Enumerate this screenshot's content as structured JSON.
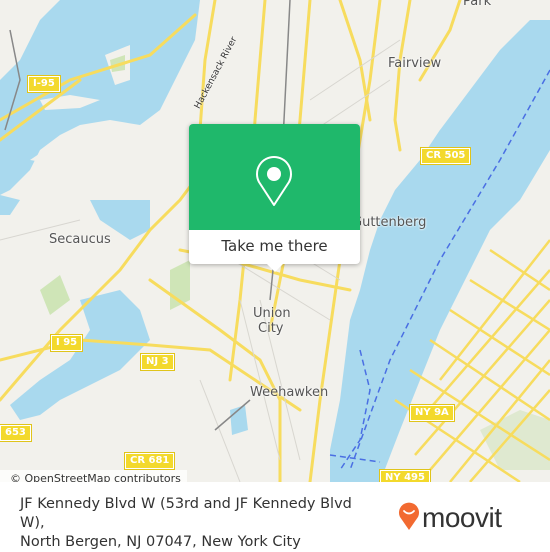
{
  "map": {
    "place_labels": [
      {
        "id": "fairview",
        "text": "Fairview"
      },
      {
        "id": "park",
        "text": "Park"
      },
      {
        "id": "secaucus",
        "text": "Secaucus"
      },
      {
        "id": "guttenberg",
        "text": "Guttenberg"
      },
      {
        "id": "union-city-1",
        "text": "Union"
      },
      {
        "id": "union-city-2",
        "text": "City"
      },
      {
        "id": "weehawken",
        "text": "Weehawken"
      }
    ],
    "water_labels": [
      {
        "id": "hackensack",
        "text": "Hackensack River"
      }
    ],
    "route_shields": [
      {
        "id": "i95-top",
        "text": "I-95"
      },
      {
        "id": "i95-mid",
        "text": "I 95"
      },
      {
        "id": "nj3",
        "text": "NJ 3"
      },
      {
        "id": "cr505",
        "text": "CR 505"
      },
      {
        "id": "ny9a",
        "text": "NY 9A"
      },
      {
        "id": "653",
        "text": "653"
      },
      {
        "id": "cr681",
        "text": "CR 681"
      },
      {
        "id": "ny495",
        "text": "NY 495"
      }
    ],
    "attribution": "© OpenStreetMap contributors",
    "colors": {
      "water": "#a9d9ee",
      "land": "#f2f1ec",
      "road": "#f7dc5e",
      "park": "#cfe5b7",
      "ferry": "#4a6fe3"
    }
  },
  "popup": {
    "icon": "map-pin-icon",
    "button_label": "Take me there",
    "color": "#1fb86b"
  },
  "footer": {
    "address_line1": "JF Kennedy Blvd W (53rd and JF Kennedy Blvd W),",
    "address_line2": "North Bergen, NJ 07047, New York City",
    "logo_text": "moovit",
    "logo_color": "#f26a31"
  }
}
